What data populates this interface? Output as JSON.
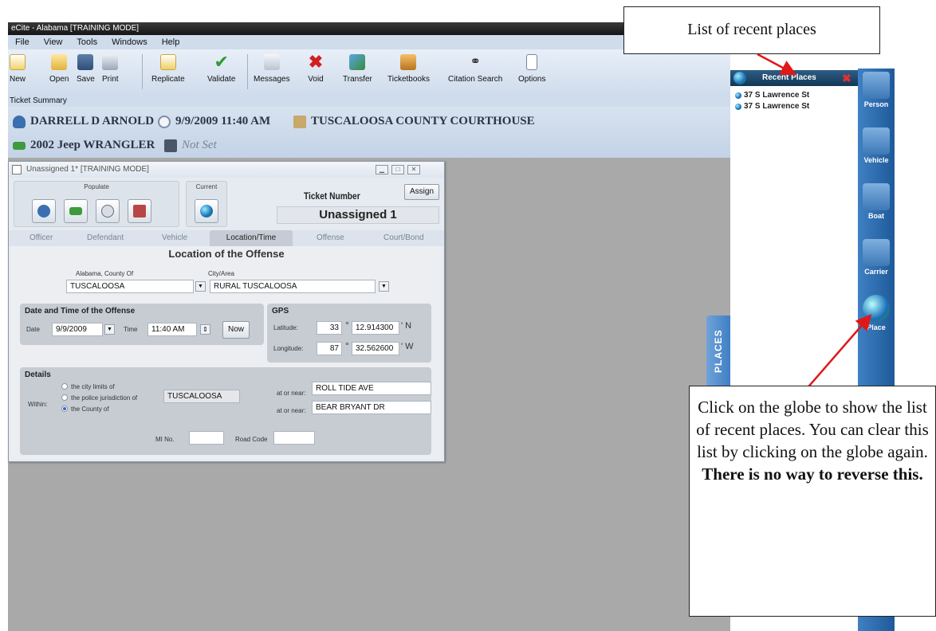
{
  "app": {
    "title": "eCite - Alabama [TRAINING MODE]",
    "menu": [
      "File",
      "View",
      "Tools",
      "Windows",
      "Help"
    ]
  },
  "toolbar": {
    "buttons": [
      {
        "label": "New",
        "icon": "new-doc-icon"
      },
      {
        "label": "Open",
        "icon": "open-folder-icon"
      },
      {
        "label": "Save",
        "icon": "save-icon"
      },
      {
        "label": "Print",
        "icon": "print-icon"
      },
      {
        "label": "Replicate",
        "icon": "replicate-icon"
      },
      {
        "label": "Validate",
        "icon": "check-icon"
      },
      {
        "label": "Messages",
        "icon": "messages-icon"
      },
      {
        "label": "Void",
        "icon": "void-x-icon"
      },
      {
        "label": "Transfer",
        "icon": "transfer-icon"
      },
      {
        "label": "Ticketbooks",
        "icon": "ticketbook-icon"
      },
      {
        "label": "Citation Search",
        "icon": "binoculars-icon"
      },
      {
        "label": "Options",
        "icon": "options-icon"
      }
    ]
  },
  "summary": {
    "label": "Ticket Summary",
    "person": "DARRELL D ARNOLD",
    "datetime": "9/9/2009 11:40 AM",
    "location": "TUSCALOOSA COUNTY COURTHOUSE",
    "vehicle": "2002 Jeep WRANGLER",
    "notset": "Not Set"
  },
  "ticket": {
    "window_title": "Unassigned 1* [TRAINING MODE]",
    "populate_label": "Populate",
    "current_label": "Current",
    "ticket_number_label": "Ticket Number",
    "ticket_number": "Unassigned 1",
    "assign_label": "Assign",
    "tabs": [
      "Officer",
      "Defendant",
      "Vehicle",
      "Location/Time",
      "Offense",
      "Court/Bond"
    ],
    "active_tab": "Location/Time",
    "section_title": "Location of the Offense",
    "county_label": "Alabama, County Of",
    "county": "TUSCALOOSA",
    "city_label": "City/Area",
    "city": "RURAL TUSCALOOSA",
    "datetime_header": "Date and Time of the Offense",
    "date_label": "Date",
    "date": "9/9/2009",
    "time_label": "Time",
    "time": "11:40 AM",
    "now_label": "Now",
    "gps": {
      "header": "GPS",
      "lat_label": "Latitude:",
      "lat_deg": "33",
      "lat_min": "12.914300",
      "lat_dir": "' N",
      "lon_label": "Longitude:",
      "lon_deg": "87",
      "lon_min": "32.562600",
      "lon_dir": "' W",
      "deg_symbol": "°"
    },
    "details": {
      "header": "Details",
      "within_label": "Within:",
      "options": [
        "the city limits of",
        "the police jurisdiction of",
        "the County of"
      ],
      "selected_index": 2,
      "jurisdiction": "TUSCALOOSA",
      "at_or_near_label": "at or near:",
      "street1": "ROLL TIDE AVE",
      "street2": "BEAR BRYANT DR",
      "mi_label": "MI No.",
      "road_code_label": "Road Code"
    }
  },
  "places_tab": "PLACES",
  "recent_places": {
    "title": "Recent Places",
    "items": [
      "37 S Lawrence St",
      "37 S Lawrence St"
    ]
  },
  "side_nav": [
    "Person",
    "Vehicle",
    "Boat",
    "Carrier",
    "Place"
  ],
  "callouts": {
    "top": "List of recent places",
    "bottom_plain": "Click on the globe to show the list of recent places. You can clear this list by clicking on the globe again.",
    "bottom_bold": "There is no way to reverse this."
  },
  "colors": {
    "accent": "#2f6fb4",
    "annotation_arrow": "#e01818",
    "workspace": "#a9a9a9"
  }
}
